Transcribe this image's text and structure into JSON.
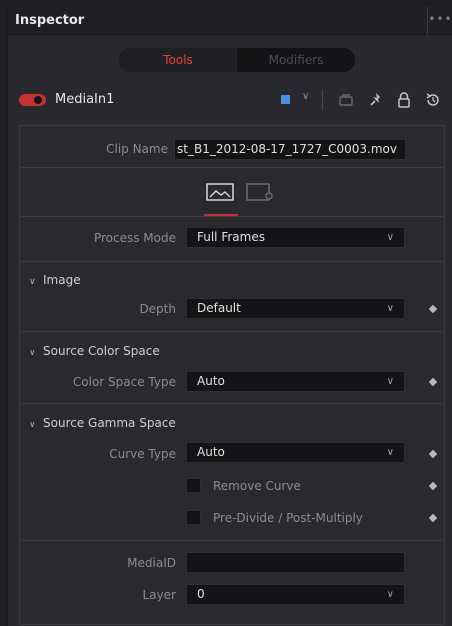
{
  "inspector": {
    "title": "Inspector",
    "menu_icon": "more-dots-icon"
  },
  "tabs": {
    "tools": "Tools",
    "modifiers": "Modifiers",
    "active_color": "#e5413b"
  },
  "node": {
    "name": "MediaIn1",
    "enabled": true,
    "toggle_color": "#c6322f",
    "color_tag": "#4a8fe0",
    "icons": [
      "color-dropdown-chevron-icon",
      "version-icon",
      "pin-icon",
      "lock-icon",
      "reset-icon"
    ]
  },
  "clip": {
    "label": "Clip Name",
    "value": "st_B1_2012-08-17_1727_C0003.mov"
  },
  "subtabs": [
    "image-icon",
    "settings-icon"
  ],
  "process_mode": {
    "label": "Process Mode",
    "value": "Full Frames"
  },
  "image": {
    "section": "Image",
    "depth_label": "Depth",
    "depth_value": "Default"
  },
  "source_color": {
    "section": "Source Color Space",
    "type_label": "Color Space Type",
    "type_value": "Auto"
  },
  "source_gamma": {
    "section": "Source Gamma Space",
    "curve_label": "Curve Type",
    "curve_value": "Auto",
    "remove_curve": "Remove Curve",
    "predivide": "Pre-Divide / Post-Multiply"
  },
  "media": {
    "id_label": "MediaID",
    "id_value": "",
    "layer_label": "Layer",
    "layer_value": "0"
  }
}
